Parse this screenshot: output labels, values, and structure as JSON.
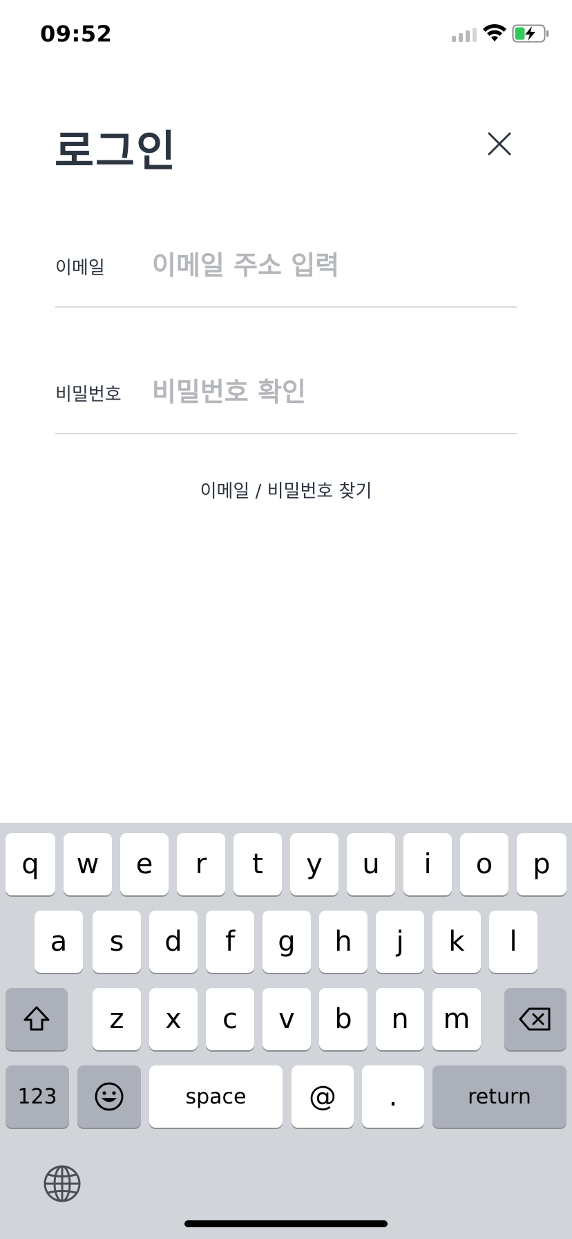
{
  "status_bar": {
    "time": "09:52"
  },
  "header": {
    "title": "로그인"
  },
  "form": {
    "email": {
      "label": "이메일",
      "placeholder": "이메일 주소 입력"
    },
    "password": {
      "label": "비밀번호",
      "placeholder": "비밀번호 확인"
    },
    "find_link": "이메일 / 비밀번호 찾기"
  },
  "keyboard": {
    "row1": [
      "q",
      "w",
      "e",
      "r",
      "t",
      "y",
      "u",
      "i",
      "o",
      "p"
    ],
    "row2": [
      "a",
      "s",
      "d",
      "f",
      "g",
      "h",
      "j",
      "k",
      "l"
    ],
    "row3": [
      "z",
      "x",
      "c",
      "v",
      "b",
      "n",
      "m"
    ],
    "numbers_label": "123",
    "space_label": "space",
    "at_label": "@",
    "period_label": ".",
    "return_label": "return"
  }
}
